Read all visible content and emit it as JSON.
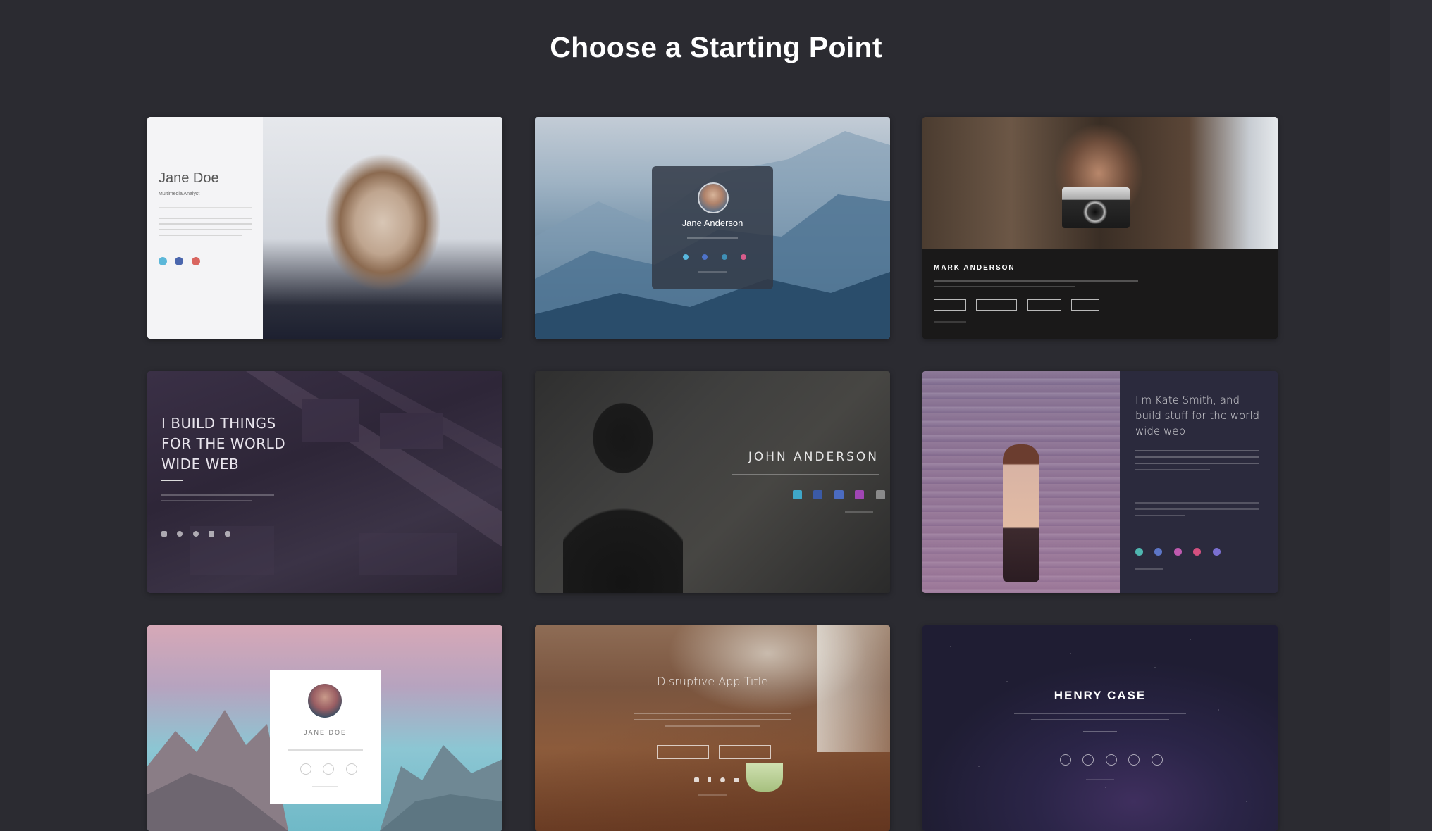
{
  "page": {
    "title": "Choose a Starting Point"
  },
  "templates": [
    {
      "name": "Jane Doe",
      "subtitle": "Multimedia Analyst"
    },
    {
      "name": "Jane Anderson"
    },
    {
      "name": "MARK ANDERSON"
    },
    {
      "headline": [
        "I BUILD THINGS",
        "FOR THE WORLD",
        "WIDE WEB"
      ]
    },
    {
      "name": "JOHN ANDERSON"
    },
    {
      "headline": [
        "I'm Kate Smith, and",
        "build stuff for the world",
        "wide web"
      ]
    },
    {
      "name": "JANE DOE"
    },
    {
      "title": "Disruptive App Title"
    },
    {
      "name": "HENRY CASE"
    }
  ]
}
